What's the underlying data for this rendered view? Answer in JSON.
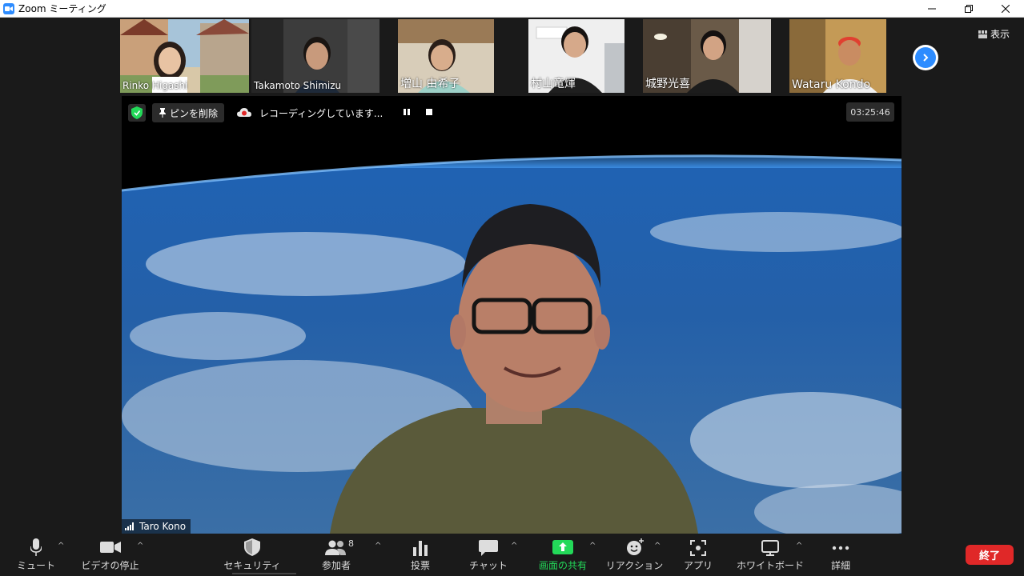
{
  "window": {
    "title": "Zoom ミーティング"
  },
  "participants": [
    {
      "name": "Rinko Higashi"
    },
    {
      "name": "Takamoto Shimizu"
    },
    {
      "name": "増山 由希子"
    },
    {
      "name": "村山竜煇"
    },
    {
      "name": "城野光喜"
    },
    {
      "name": "Wataru Kondo"
    }
  ],
  "view_button": {
    "label": "表示"
  },
  "recording": {
    "pin_label": "ピンを削除",
    "status": "レコーディングしています...",
    "elapsed": "03:25:46"
  },
  "active_speaker": {
    "name": "Taro Kono"
  },
  "toolbar": {
    "mute": "ミュート",
    "stop_video": "ビデオの停止",
    "security": "セキュリティ",
    "participants": "参加者",
    "participant_count": "8",
    "polls": "投票",
    "chat": "チャット",
    "share_screen": "画面の共有",
    "reactions": "リアクション",
    "apps": "アプリ",
    "whiteboard": "ホワイトボード",
    "more": "詳細",
    "end": "終了"
  },
  "colors": {
    "accent": "#2d8cff",
    "share_green": "#23d959",
    "end_red": "#e02828",
    "shield_green": "#23d959"
  }
}
